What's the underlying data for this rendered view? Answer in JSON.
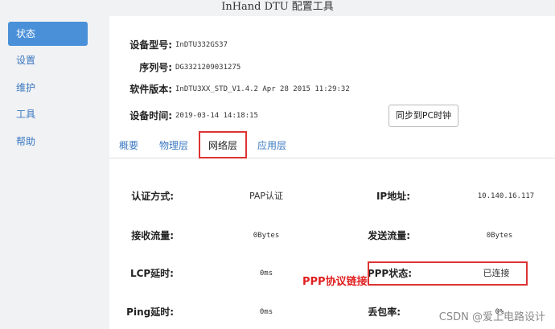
{
  "window": {
    "title": "InHand DTU 配置工具"
  },
  "sidebar": {
    "items": [
      {
        "label": "状态",
        "active": true
      },
      {
        "label": "设置",
        "active": false
      },
      {
        "label": "维护",
        "active": false
      },
      {
        "label": "工具",
        "active": false
      },
      {
        "label": "帮助",
        "active": false
      }
    ]
  },
  "device": {
    "model_label": "设备型号:",
    "model_value": "InDTU332GS37",
    "serial_label": "序列号:",
    "serial_value": "DG3321209031275",
    "firmware_label": "软件版本:",
    "firmware_value": "InDTU3XX_STD_V1.4.2 Apr 28 2015 11:29:32",
    "time_label": "设备时间:",
    "time_value": "2019-03-14 14:18:15",
    "sync_button": "同步到PC时钟"
  },
  "tabs": [
    {
      "label": "概要",
      "active": false
    },
    {
      "label": "物理层",
      "active": false
    },
    {
      "label": "网络层",
      "active": true
    },
    {
      "label": "应用层",
      "active": false
    }
  ],
  "network": {
    "auth_label": "认证方式:",
    "auth_value": "PAP认证",
    "ip_label": "IP地址:",
    "ip_value": "10.140.16.117",
    "rx_label": "接收流量:",
    "rx_value": "0Bytes",
    "tx_label": "发送流量:",
    "tx_value": "0Bytes",
    "lcp_label": "LCP延时:",
    "lcp_value": "0ms",
    "ppp_label": "PPP状态:",
    "ppp_value": "已连接",
    "ping_label": "Ping延时:",
    "ping_value": "0ms",
    "loss_label": "丢包率:",
    "loss_value": "0%"
  },
  "annotation": {
    "text": "PPP协议链接"
  },
  "watermark": {
    "text": "CSDN @爱上电路设计"
  },
  "colors": {
    "highlight": "#dd3333",
    "accent": "#4a90d9",
    "link": "#3a78c0",
    "annotation": "#e02020"
  }
}
